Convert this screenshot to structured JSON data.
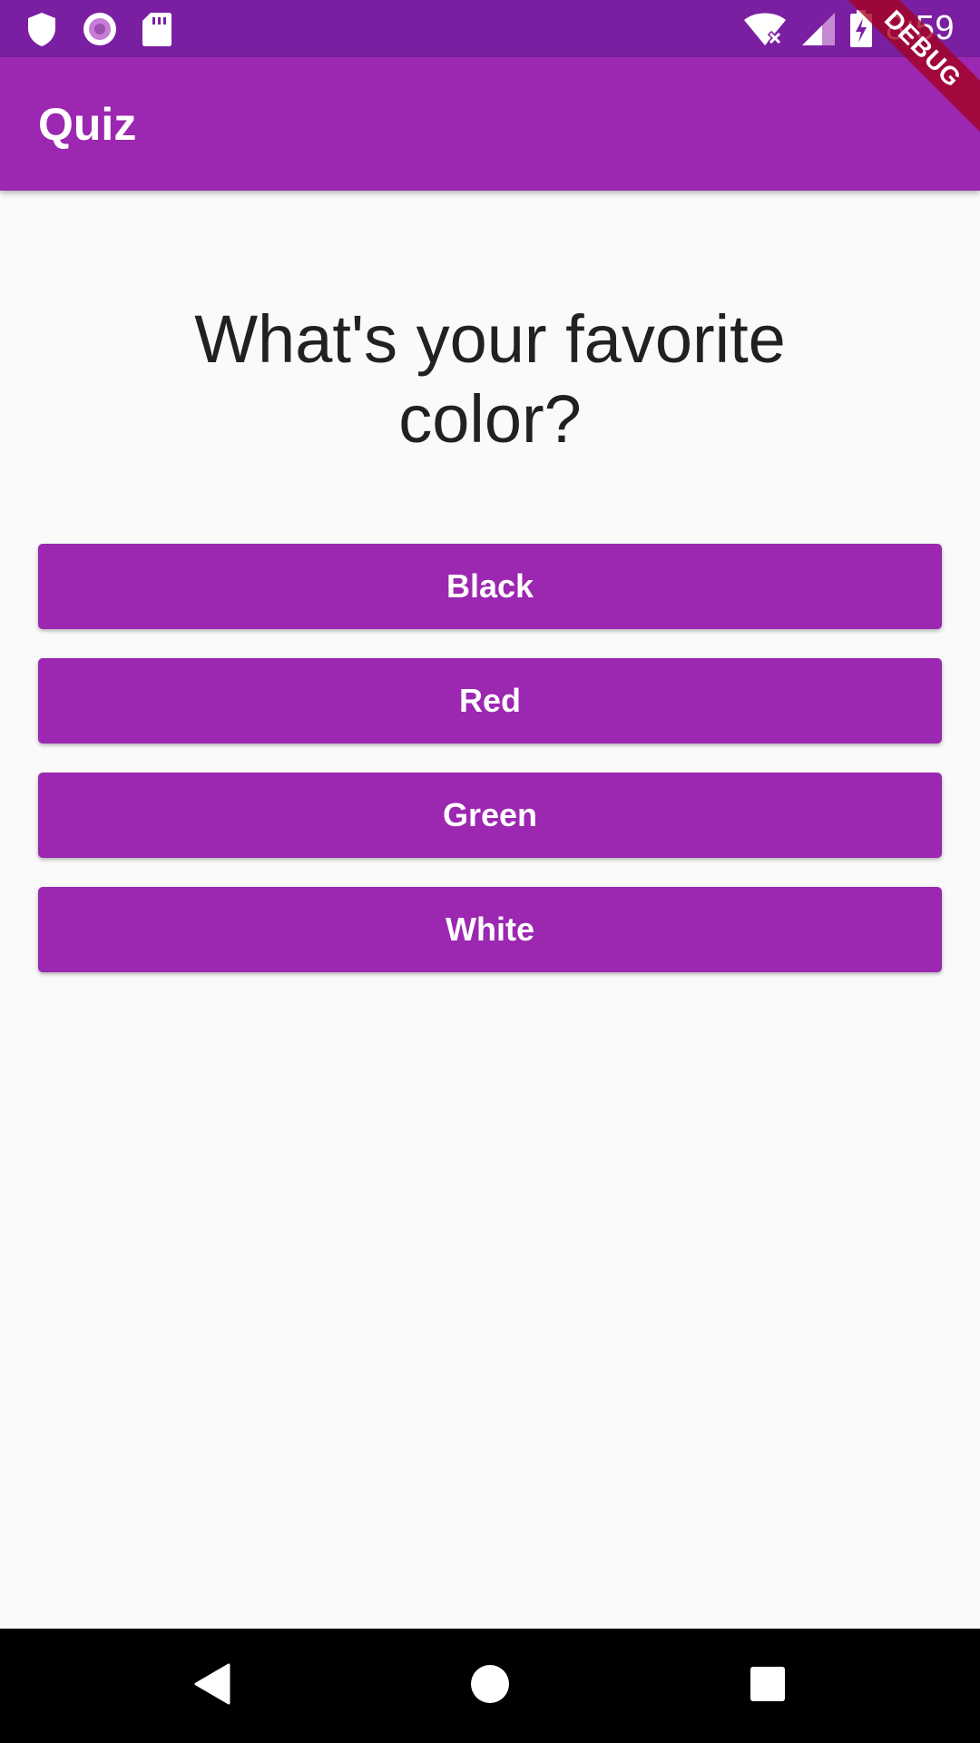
{
  "status_bar": {
    "time": "8:59",
    "left_icons": [
      "shield-icon",
      "record-icon",
      "sd-card-icon"
    ],
    "right_icons": [
      "wifi-off-icon",
      "signal-icon",
      "battery-charging-icon"
    ]
  },
  "app_bar": {
    "title": "Quiz"
  },
  "debug_banner": {
    "label": "DEBUG"
  },
  "question": {
    "text": "What's your favorite\ncolor?"
  },
  "answers": [
    {
      "label": "Black"
    },
    {
      "label": "Red"
    },
    {
      "label": "Green"
    },
    {
      "label": "White"
    }
  ],
  "nav_bar": {
    "icons": [
      "back-icon",
      "home-icon",
      "recents-icon"
    ]
  },
  "colors": {
    "primary": "#9c27b0",
    "primary_dark": "#7b1fa2",
    "background": "#fafafa",
    "text": "#212121",
    "debug": "#a4001e"
  }
}
